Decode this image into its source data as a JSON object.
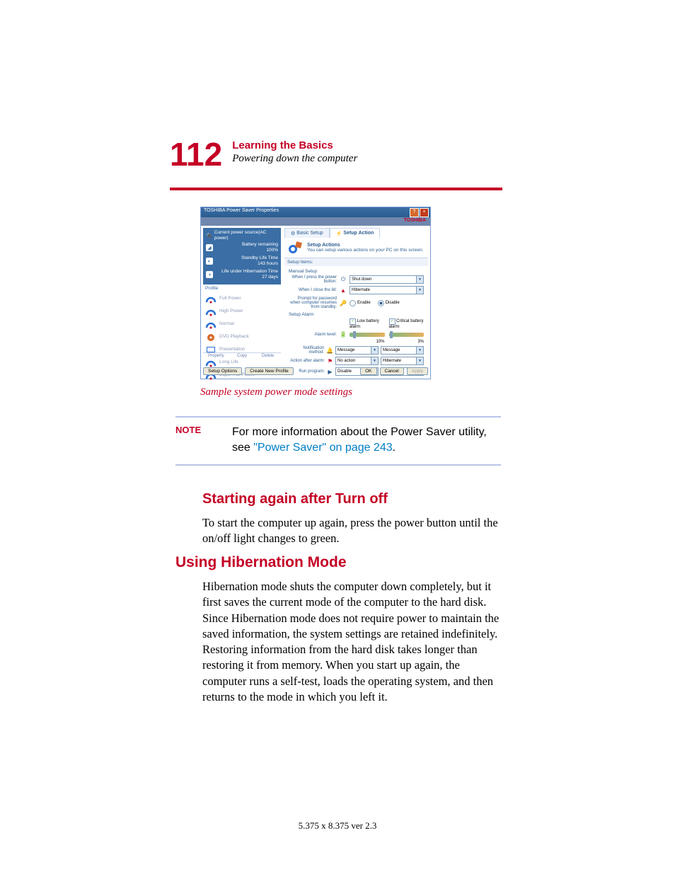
{
  "header": {
    "page_number": "112",
    "chapter": "Learning the Basics",
    "section": "Powering down the computer"
  },
  "figure": {
    "title": "TOSHIBA Power Saver Properties",
    "brand": "TOSHIBA",
    "status": {
      "header": "Current power source(AC power)",
      "battery_remaining": "Battery remaining",
      "battery_remaining_val": "100%",
      "standby": "Standby Life Time",
      "standby_val": "143 hours",
      "hibernate": "Life under Hibernation Time",
      "hibernate_val": "27 days"
    },
    "profile_header": "Profile",
    "profiles": [
      "Full Power",
      "High Power",
      "Normal",
      "DVD Playback",
      "Presentation",
      "Long Life",
      "Super Full Power"
    ],
    "left_tabs": [
      "Property",
      "Copy",
      "Delete"
    ],
    "tabs": {
      "basic": "Basic Setup",
      "action": "Setup Action"
    },
    "rp_header": {
      "title": "Setup Actions",
      "sub": "You can setup various actions on your PC on this screen."
    },
    "setup_items": "Setup Items:",
    "manual": {
      "title": "Manual Setup",
      "power_button_lbl": "When I press the power button:",
      "power_button_val": "Shut down",
      "lid_lbl": "When I close the lid:",
      "lid_val": "Hibernate",
      "pw_lbl": "Prompt for password when computer resumes from standby:",
      "enable": "Enable",
      "disable": "Disable"
    },
    "alarm": {
      "title": "Setup Alarm",
      "low_lbl": "Low battery alarm",
      "crit_lbl": "Critical battery alarm",
      "level_lbl": "Alarm level:",
      "low_pct": "10%",
      "crit_pct": "3%",
      "method_lbl": "Notification method:",
      "method_low": "Message",
      "method_crit": "Message",
      "action_lbl": "Action after alarm:",
      "action_low": "No action",
      "action_crit": "Hibernate",
      "prog_lbl": "Run program:",
      "prog_low": "Disable",
      "prog_crit": "Disable"
    },
    "bottom": {
      "setup_options": "Setup Options",
      "create_profile": "Create New Profile",
      "ok": "OK",
      "cancel": "Cancel",
      "apply": "Apply"
    },
    "caption": "Sample system power mode settings"
  },
  "note": {
    "label": "NOTE",
    "text_pre": "For more information about the Power Saver utility, see ",
    "link": "\"Power Saver\" on page 243",
    "text_post": "."
  },
  "h1": "Starting again after Turn off",
  "p1": "To start the computer up again, press the power button until the on/off light changes to green.",
  "h2": "Using Hibernation Mode",
  "p2": "Hibernation mode shuts the computer down completely, but it first saves the current mode of the computer to the hard disk. Since Hibernation mode does not require power to maintain the saved information, the system settings are retained indefinitely. Restoring information from the hard disk takes longer than restoring it from memory. When you start up again, the computer runs a self-test, loads the operating system, and then returns to the mode in which you left it.",
  "footer": "5.375 x 8.375 ver 2.3"
}
